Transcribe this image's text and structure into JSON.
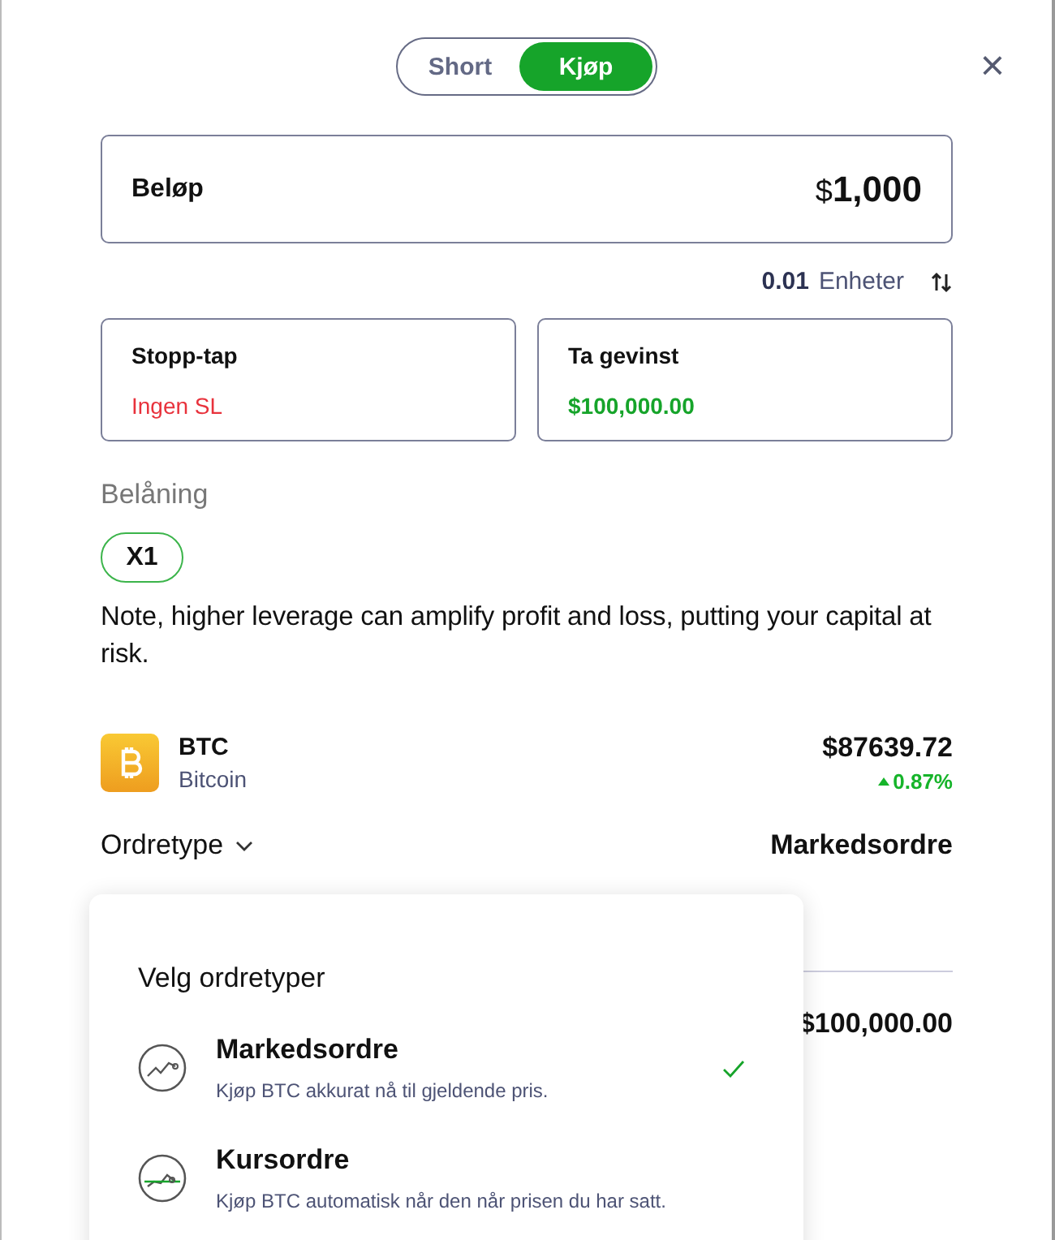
{
  "side_toggle": [
    {
      "label": "Short",
      "selected": false
    },
    {
      "label": "Kjøp",
      "selected": true
    }
  ],
  "close": "×",
  "amount": {
    "label": "Beløp",
    "currency": "$",
    "value": "1,000"
  },
  "units": {
    "value": "0.01",
    "label": "Enheter"
  },
  "stop_loss": {
    "label": "Stopp-tap",
    "value": "Ingen SL"
  },
  "take_profit": {
    "label": "Ta gevinst",
    "value": "$100,000.00"
  },
  "leverage": {
    "label": "Belåning",
    "options": [
      {
        "label": "X1",
        "selected": true
      }
    ],
    "note": "Note, higher leverage can amplify profit and loss, putting your capital at risk."
  },
  "asset": {
    "symbol": "BTC",
    "name": "Bitcoin",
    "price": "$87639.72",
    "change": "0.87%",
    "change_up": true
  },
  "order_type": {
    "label": "Ordretype",
    "value": "Markedsordre"
  },
  "behind_value": "$100,000.00",
  "order_menu": {
    "title": "Velg ordretyper",
    "items": [
      {
        "kind": "market",
        "title": "Markedsordre",
        "description": "Kjøp BTC akkurat nå til gjeldende pris.",
        "selected": true
      },
      {
        "kind": "limit",
        "title": "Kursordre",
        "description": "Kjøp BTC automatisk når den når prisen du har satt.",
        "selected": false
      }
    ]
  }
}
